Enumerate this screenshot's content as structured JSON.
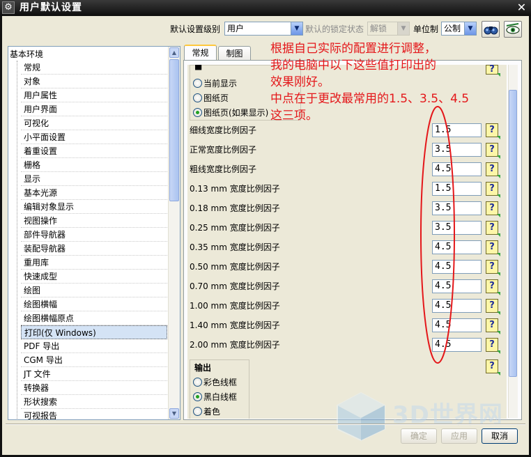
{
  "window": {
    "title": "用户默认设置"
  },
  "toolbar": {
    "level_label": "默认设置级别",
    "level_value": "用户",
    "lock_label": "默认的锁定状态",
    "lock_value": "解锁",
    "unit_label": "单位制",
    "unit_value": "公制"
  },
  "tree": {
    "root": "基本环境",
    "items": [
      "常规",
      "对象",
      "用户属性",
      "用户界面",
      "可视化",
      "小平面设置",
      "着重设置",
      "栅格",
      "显示",
      "基本光源",
      "编辑对象显示",
      "视图操作",
      "部件导航器",
      "装配导航器",
      "重用库",
      "快速成型",
      "绘图",
      "绘图横幅",
      "绘图横幅原点",
      "打印(仅 Windows)",
      "PDF 导出",
      "CGM 导出",
      "JT 文件",
      "转换器",
      "形状搜索",
      "可视报告"
    ],
    "selected_index": 19
  },
  "tabs": [
    {
      "label": "常规"
    },
    {
      "label": "制图"
    }
  ],
  "display_group": {
    "options": [
      {
        "label": "当前显示",
        "checked": false
      },
      {
        "label": "图纸页",
        "checked": false
      },
      {
        "label": "图纸页(如果显示)",
        "checked": true
      }
    ]
  },
  "factors": [
    {
      "label": "细线宽度比例因子",
      "value": "1.5"
    },
    {
      "label": "正常宽度比例因子",
      "value": "3.5"
    },
    {
      "label": "粗线宽度比例因子",
      "value": "4.5"
    },
    {
      "label": "0.13 mm 宽度比例因子",
      "value": "1.5"
    },
    {
      "label": "0.18 mm 宽度比例因子",
      "value": "3.5"
    },
    {
      "label": "0.25 mm 宽度比例因子",
      "value": "3.5"
    },
    {
      "label": "0.35 mm 宽度比例因子",
      "value": "4.5"
    },
    {
      "label": "0.50 mm 宽度比例因子",
      "value": "4.5"
    },
    {
      "label": "0.70 mm 宽度比例因子",
      "value": "4.5"
    },
    {
      "label": "1.00 mm 宽度比例因子",
      "value": "4.5"
    },
    {
      "label": "1.40 mm 宽度比例因子",
      "value": "4.5"
    },
    {
      "label": "2.00 mm 宽度比例因子",
      "value": "4.5"
    }
  ],
  "help_glyph": "?",
  "output_group": {
    "title": "输出",
    "options": [
      {
        "label": "彩色线框",
        "checked": false
      },
      {
        "label": "黑白线框",
        "checked": true
      },
      {
        "label": "着色",
        "checked": false
      }
    ]
  },
  "annotation": {
    "lines": [
      "根据自己实际的配置进行调整，",
      "我的电脑中以下这些值打印出的",
      "效果刚好。",
      "中点在于更改最常用的1.5、3.5、4.5",
      "这三项。"
    ],
    "color": "#e4171a"
  },
  "buttons": {
    "ok": "确定",
    "apply": "应用",
    "cancel": "取消"
  },
  "watermark": {
    "text": "3D世界网"
  }
}
